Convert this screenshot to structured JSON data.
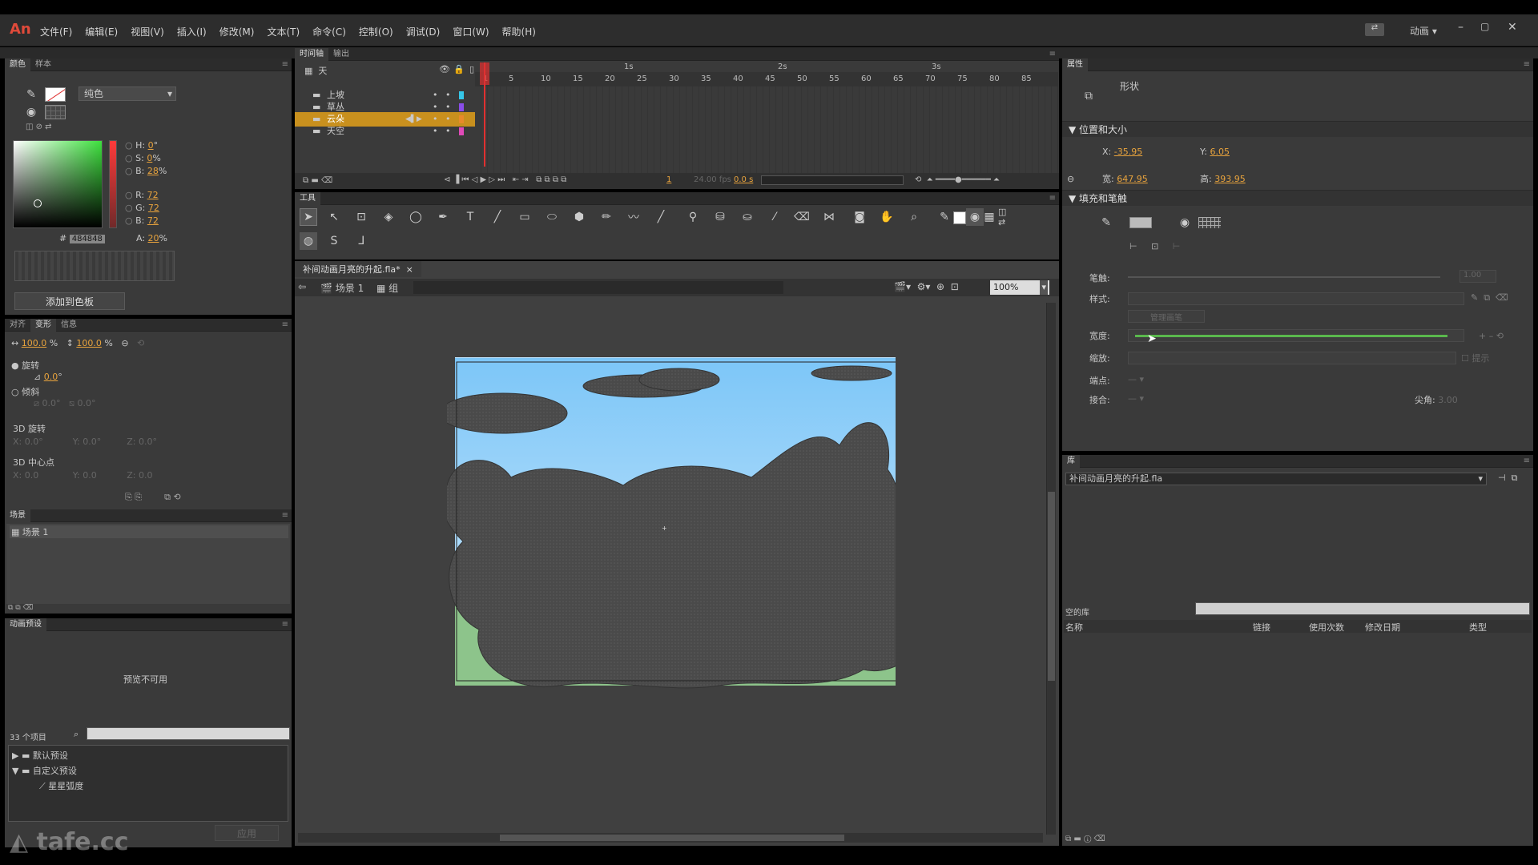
{
  "app": {
    "logo": "An",
    "workspace": "动画",
    "menu": [
      "文件(F)",
      "编辑(E)",
      "视图(V)",
      "插入(I)",
      "修改(M)",
      "文本(T)",
      "命令(C)",
      "控制(O)",
      "调试(D)",
      "窗口(W)",
      "帮助(H)"
    ]
  },
  "color_panel": {
    "tabs": [
      "颜色",
      "样本"
    ],
    "fill_type": "纯色",
    "hsb": [
      {
        "k": "H:",
        "v": "0",
        "u": "°"
      },
      {
        "k": "S:",
        "v": "0",
        "u": "%"
      },
      {
        "k": "B:",
        "v": "28",
        "u": "%"
      }
    ],
    "rgb": [
      {
        "k": "R:",
        "v": "72"
      },
      {
        "k": "G:",
        "v": "72"
      },
      {
        "k": "B:",
        "v": "72"
      }
    ],
    "alpha_label": "A:",
    "alpha": "20",
    "alpha_unit": "%",
    "hex_prefix": "#",
    "hex": "484848",
    "add_swatch": "添加到色板"
  },
  "transform": {
    "tabs": [
      "对齐",
      "变形",
      "信息"
    ],
    "w": "100.0",
    "h": "100.0",
    "pct": "%",
    "rotate_label": "旋转",
    "rotate_val": "0.0",
    "deg": "°",
    "skew_label": "倾斜",
    "skew_v1": "0.0°",
    "skew_v2": "0.0°",
    "rot3d": "3D 旋转",
    "center3d": "3D 中心点",
    "rot3d_x": "0.0°",
    "rot3d_y": "0.0°",
    "rot3d_z": "0.0°",
    "c_x": "0.0",
    "c_y": "0.0",
    "c_z": "0.0",
    "xl": "X:",
    "yl": "Y:",
    "zl": "Z:"
  },
  "scene_panel": {
    "title": "场景",
    "item": "场景 1"
  },
  "presets": {
    "title": "动画预设",
    "preview": "预览不可用",
    "count": "33 个项目",
    "tree": [
      "默认预设",
      "自定义预设",
      "星星弧度"
    ],
    "apply": "应用"
  },
  "timeline": {
    "tabs": [
      "时间轴",
      "输出"
    ],
    "header": "天",
    "seconds": [
      "1s",
      "2s",
      "3s"
    ],
    "frames": [
      "1",
      "5",
      "10",
      "15",
      "20",
      "25",
      "30",
      "35",
      "40",
      "45",
      "50",
      "55",
      "60",
      "65",
      "70",
      "75",
      "80",
      "85"
    ],
    "layers": [
      {
        "name": "上坡",
        "color": "#36c6e8"
      },
      {
        "name": "草丛",
        "color": "#8a4de8"
      },
      {
        "name": "云朵",
        "color": "#e88a2a"
      },
      {
        "name": "天空",
        "color": "#e04ab8"
      }
    ],
    "cur_frame": "1",
    "fps": "24.00 fps",
    "time": "0.0 s"
  },
  "tools": {
    "title": "工具"
  },
  "doc": {
    "tab": "补间动画月亮的升起.fla*",
    "scene": "场景 1",
    "group": "组",
    "zoom": "100%"
  },
  "props": {
    "title": "属性",
    "shape": "形状",
    "pos_size": "位置和大小",
    "x_label": "X:",
    "x": "-35.95",
    "y_label": "Y:",
    "y": "6.05",
    "w_label": "宽:",
    "w": "647.95",
    "h_label": "高:",
    "h": "393.95",
    "fill_stroke": "填充和笔触",
    "stroke_label": "笔触:",
    "stroke_val": "1.00",
    "style_label": "样式:",
    "manage": "管理画笔",
    "width_label": "宽度:",
    "scale_label": "缩放:",
    "hint": "提示",
    "cap_label": "端点:",
    "join_label": "接合:",
    "miter_label": "尖角:",
    "miter": "3.00"
  },
  "library": {
    "title": "库",
    "file": "补间动画月亮的升起.fla",
    "empty": "空的库",
    "cols": [
      "名称",
      "链接",
      "使用次数",
      "修改日期",
      "类型"
    ]
  },
  "watermark": "tafe.cc"
}
